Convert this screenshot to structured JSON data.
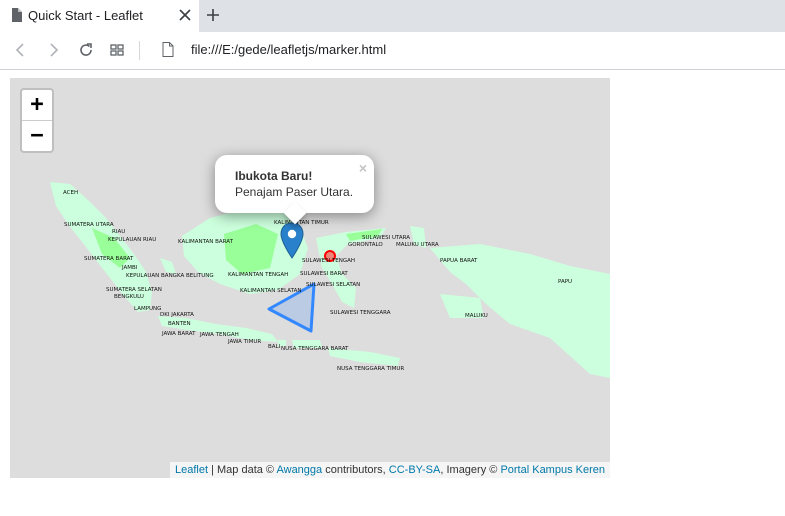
{
  "browser": {
    "tab_title": "Quick Start - Leaflet",
    "url": "file:///E:/gede/leafletjs/marker.html"
  },
  "map": {
    "zoom_in_label": "+",
    "zoom_out_label": "−",
    "popup": {
      "title": "Ibukota Baru!",
      "body": "Penajam Paser Utara.",
      "close": "×"
    },
    "regions": [
      "ACEH",
      "SUMATERA UTARA",
      "RIAU",
      "KEPULAUAN RIAU",
      "KALIMANTAN BARAT",
      "SUMATERA BARAT",
      "JAMBI",
      "KEPULAUAN BANGKA BELITUNG",
      "KALIMANTAN TENGAH",
      "SUMATERA SELATAN",
      "BENGKULU",
      "LAMPUNG",
      "DKI JAKARTA",
      "BANTEN",
      "JAWA BARAT",
      "JAWA TENGAH",
      "JAWA TIMUR",
      "BALI",
      "NUSA TENGGARA BARAT",
      "NUSA TENGGARA TIMUR",
      "KALIMANTAN SELATAN",
      "KALIMANTAN TIMUR",
      "SULAWESI UTARA",
      "GORONTALO",
      "MALUKU UTARA",
      "SULAWESI TENGAH",
      "SULAWESI BARAT",
      "SULAWESI SELATAN",
      "SULAWESI TENGGARA",
      "MALUKU",
      "PAPUA BARAT",
      "PAPU"
    ],
    "attribution": {
      "leaflet": "Leaflet",
      "sep": " | Map data © ",
      "awangga": "Awangga",
      "contrib": " contributors, ",
      "license": "CC-BY-SA",
      "imagery": ", Imagery © ",
      "portal": "Portal Kampus Keren"
    },
    "colors": {
      "background": "#dddddd",
      "land_light": "#ccffdd",
      "land_green": "#99ff99",
      "triangle_stroke": "#3388ff",
      "circle": "#ff0000",
      "marker": "#2a81cb"
    }
  }
}
